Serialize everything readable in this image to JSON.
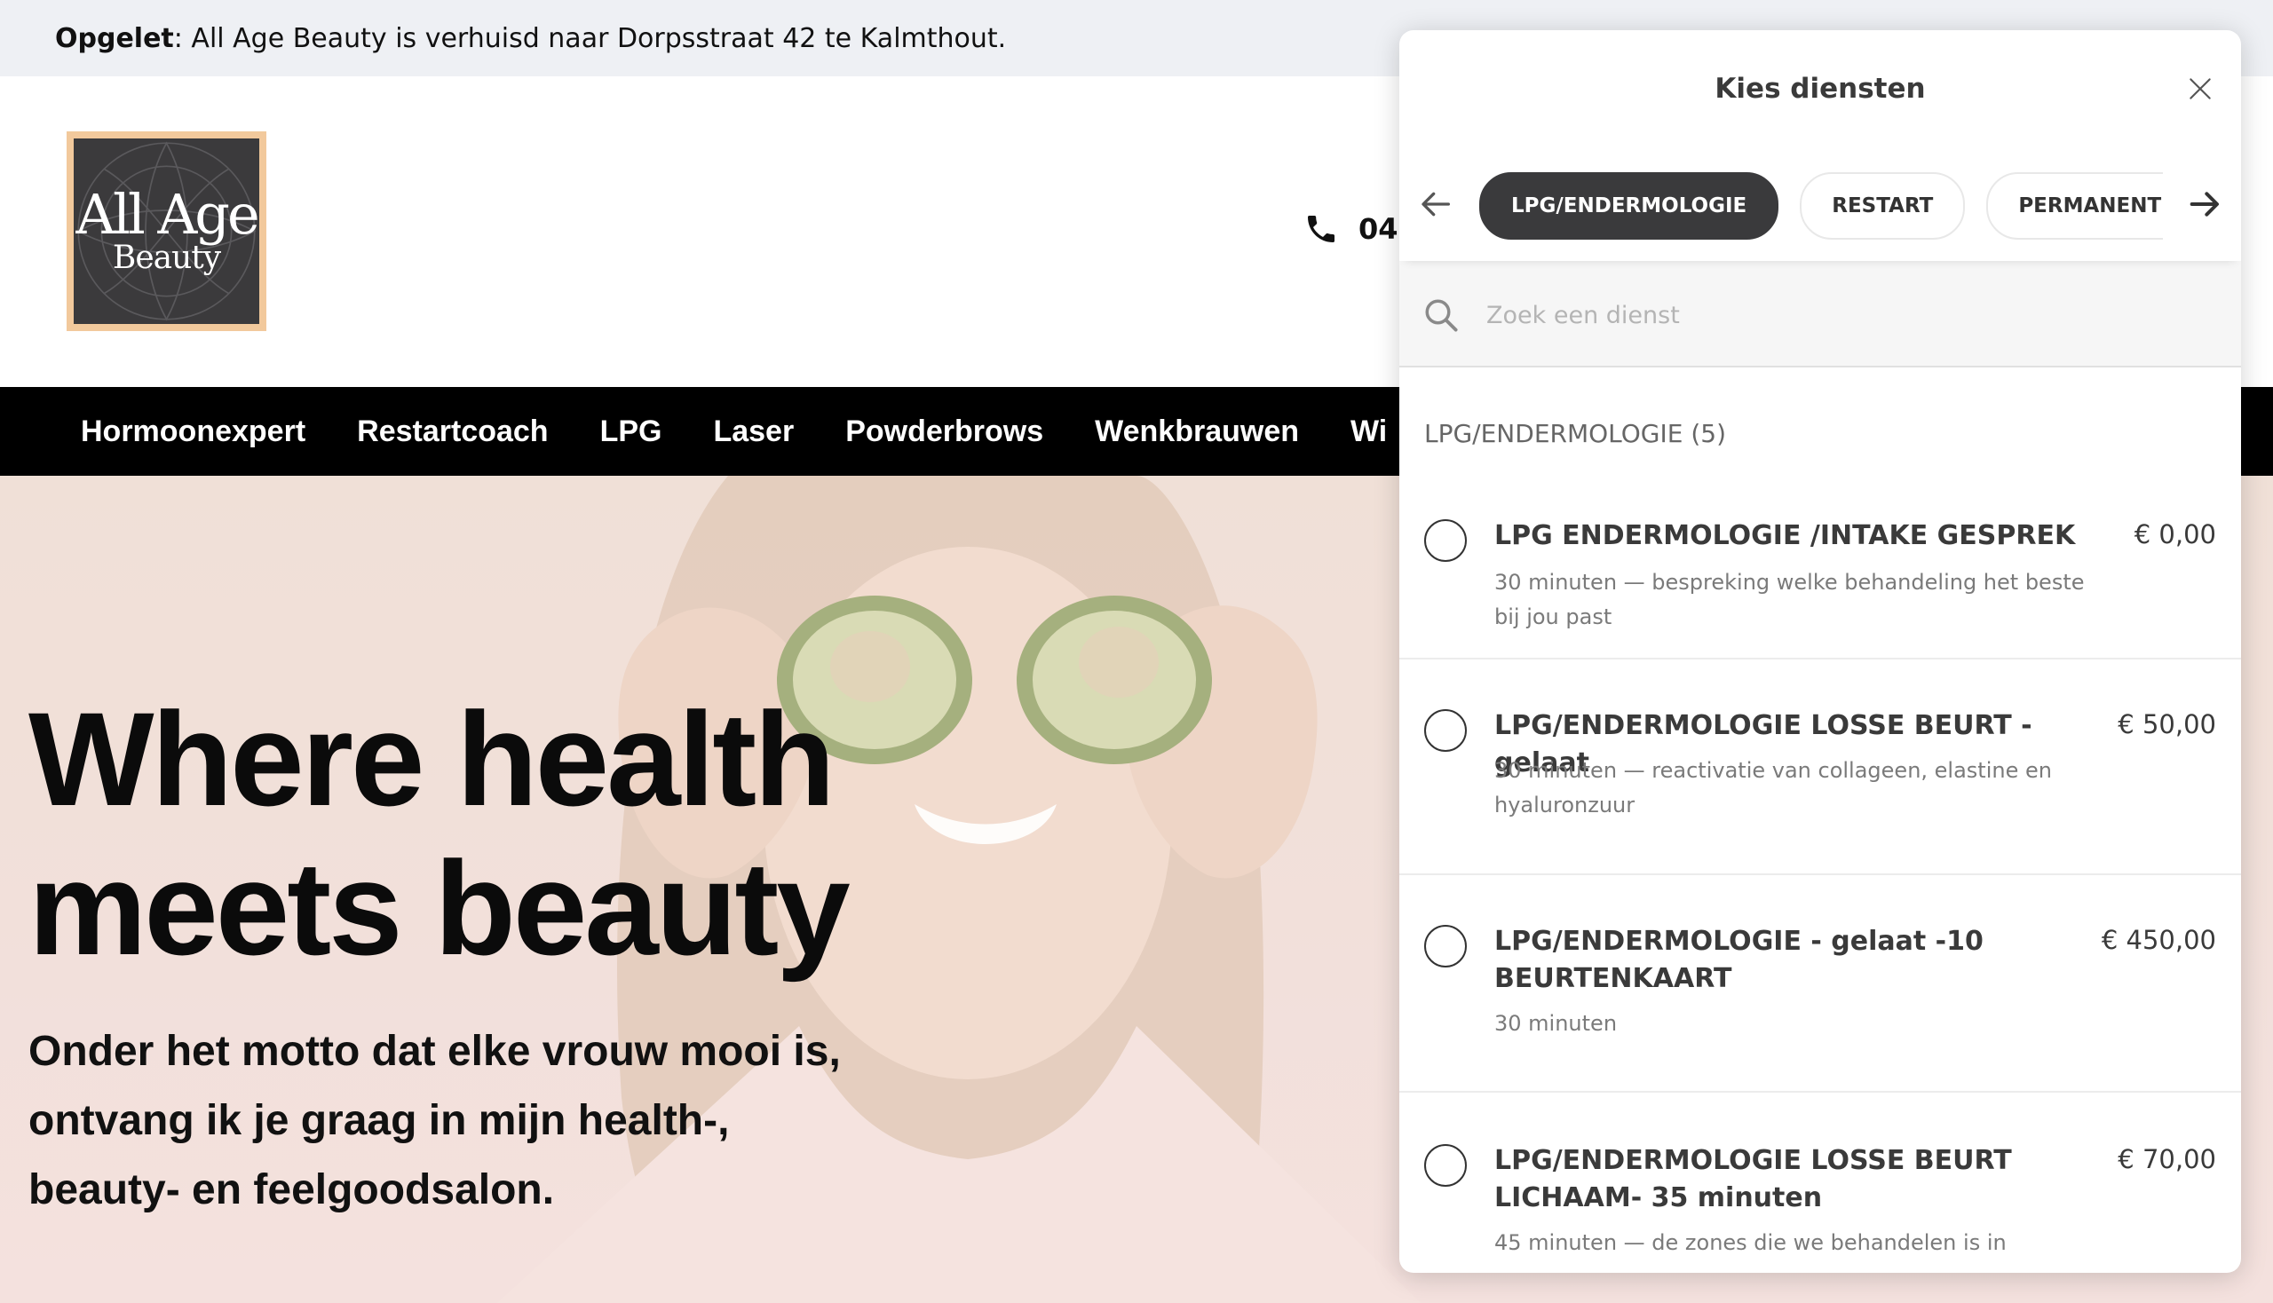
{
  "announcement": {
    "label": "Opgelet",
    "text": ": All Age Beauty is verhuisd naar Dorpsstraat 42 te Kalmthout."
  },
  "logo": {
    "line1": "All Age",
    "line2": "Beauty",
    "colors": {
      "frame": "#f2c99c",
      "background": "#3b3a3c"
    }
  },
  "header": {
    "phone": "04"
  },
  "nav": {
    "items": [
      {
        "label": "Hormoonexpert"
      },
      {
        "label": "Restartcoach"
      },
      {
        "label": "LPG"
      },
      {
        "label": "Laser"
      },
      {
        "label": "Powderbrows"
      },
      {
        "label": "Wenkbrauwen"
      },
      {
        "label": "Wi"
      }
    ]
  },
  "hero": {
    "title_line1": "Where health",
    "title_line2": "meets beauty",
    "subtitle_line1": "Onder het motto dat elke vrouw mooi is,",
    "subtitle_line2": "ontvang ik je graag in mijn health-,",
    "subtitle_line3": "beauty- en feelgoodsalon."
  },
  "modal": {
    "title": "Kies diensten",
    "close_icon": "close-icon",
    "categories": [
      {
        "label": "LPG/ENDERMOLOGIE",
        "active": true
      },
      {
        "label": "RESTART",
        "active": false
      },
      {
        "label": "PERMANENTE LA",
        "active": false
      }
    ],
    "search": {
      "placeholder": "Zoek een dienst",
      "value": ""
    },
    "section": "LPG/ENDERMOLOGIE (5)",
    "services": [
      {
        "name": "LPG ENDERMOLOGIE /INTAKE GESPREK",
        "price": "€ 0,00",
        "desc": "30 minuten — bespreking welke behandeling het beste bij jou past"
      },
      {
        "name": "LPG/ENDERMOLOGIE LOSSE BEURT - gelaat",
        "price": "€ 50,00",
        "desc": "30 minuten — reactivatie van collageen, elastine en hyaluronzuur"
      },
      {
        "name": "LPG/ENDERMOLOGIE - gelaat -10 BEURTENKAART",
        "price": "€ 450,00",
        "desc": "30 minuten"
      },
      {
        "name": "LPG/ENDERMOLOGIE LOSSE BEURT LICHAAM- 35 minuten",
        "price": "€ 70,00",
        "desc": "45 minuten — de zones die we behandelen is in"
      }
    ]
  }
}
